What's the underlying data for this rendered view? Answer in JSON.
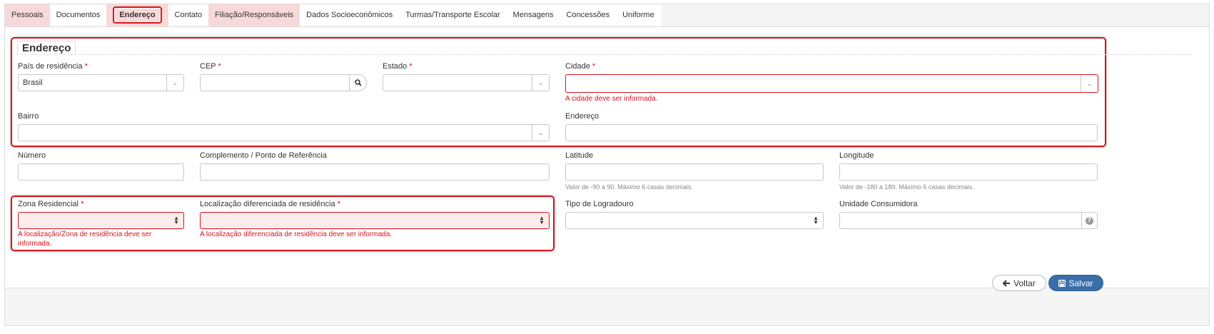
{
  "tabs": [
    {
      "label": "Pessoais",
      "state": "error"
    },
    {
      "label": "Documentos",
      "state": "normal"
    },
    {
      "label": "Endereço",
      "state": "active"
    },
    {
      "label": "Contato",
      "state": "normal"
    },
    {
      "label": "Filiação/Responsáveis",
      "state": "error"
    },
    {
      "label": "Dados Socioeconômicos",
      "state": "normal"
    },
    {
      "label": "Turmas/Transporte Escolar",
      "state": "normal"
    },
    {
      "label": "Mensagens",
      "state": "normal"
    },
    {
      "label": "Concessões",
      "state": "normal"
    },
    {
      "label": "Uniforme",
      "state": "normal"
    }
  ],
  "section_title": "Endereço",
  "required_mark": "*",
  "fields": {
    "pais": {
      "label": "País de residência",
      "value": "Brasil"
    },
    "cep": {
      "label": "CEP",
      "value": ""
    },
    "estado": {
      "label": "Estado",
      "value": ""
    },
    "cidade": {
      "label": "Cidade",
      "value": "",
      "error": "A cidade deve ser informada."
    },
    "bairro": {
      "label": "Bairro",
      "value": ""
    },
    "endereco": {
      "label": "Endereço",
      "value": ""
    },
    "numero": {
      "label": "Número",
      "value": ""
    },
    "complemento": {
      "label": "Complemento / Ponto de Referência",
      "value": ""
    },
    "latitude": {
      "label": "Latitude",
      "value": "",
      "help": "Valor de -90 a 90. Máximo 6 casas decimais."
    },
    "longitude": {
      "label": "Longitude",
      "value": "",
      "help": "Valor de -180 a 180. Máximo 6 casas decimais."
    },
    "zona": {
      "label": "Zona Residencial",
      "value": "",
      "error": "A localização/Zona de residência deve ser informada."
    },
    "localizacao": {
      "label": "Localização diferenciada de residência",
      "value": "",
      "error": "A localização diferenciada de residência deve ser informada."
    },
    "logradouro": {
      "label": "Tipo de Logradouro",
      "value": ""
    },
    "unidade": {
      "label": "Unidade Consumidora",
      "value": ""
    }
  },
  "buttons": {
    "back": "Voltar",
    "save": "Salvar"
  },
  "icons": {
    "dropdown": "chevron-down-icon",
    "spinner": "sort-icon",
    "search": "search-icon",
    "help": "question-circle-icon",
    "back": "arrow-left-icon",
    "save": "floppy-disk-icon"
  },
  "colors": {
    "error": "#d9121b",
    "error_bg": "#fdecec",
    "tab_error_bg": "#f8d9d9",
    "primary": "#3b6ea8"
  }
}
